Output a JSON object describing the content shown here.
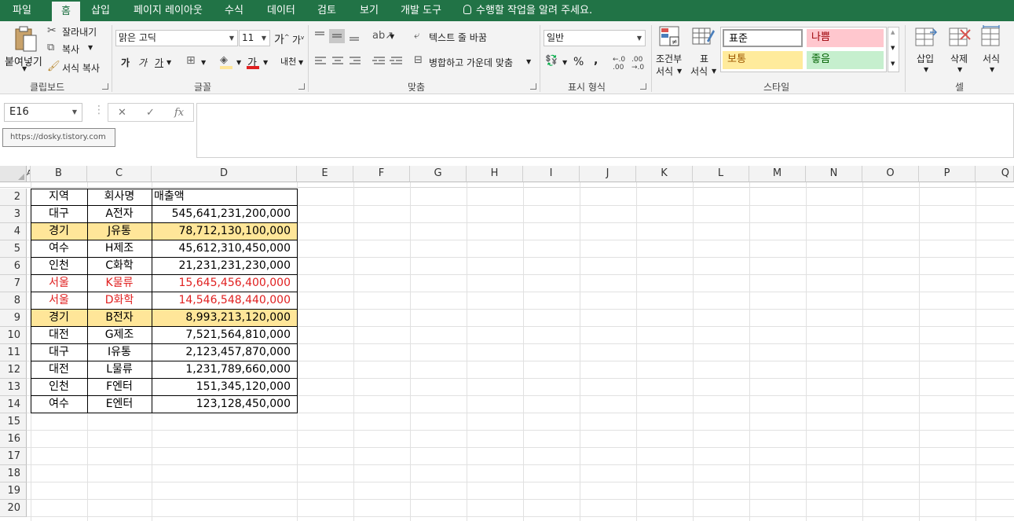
{
  "tabs": [
    "파일",
    "홈",
    "삽입",
    "페이지 레이아웃",
    "수식",
    "데이터",
    "검토",
    "보기",
    "개발 도구"
  ],
  "active_tab": "홈",
  "tell_me": "수행할 작업을 알려 주세요.",
  "clipboard": {
    "paste": "붙여넣기",
    "cut": "잘라내기",
    "copy": "복사",
    "format_painter": "서식 복사",
    "group": "클립보드"
  },
  "font": {
    "name": "맑은 고딕",
    "size": "11",
    "bold": "가",
    "italic": "가",
    "underline": "가",
    "grow": "가",
    "shrink": "가",
    "color_glyph": "가",
    "phonetic": "내천",
    "group": "글꼴"
  },
  "alignment": {
    "wrap_text": "텍스트 줄 바꿈",
    "merge_center": "병합하고 가운데 맞춤",
    "group": "맞춤"
  },
  "number": {
    "format": "일반",
    "percent": "%",
    "comma": ",",
    "group": "표시 형식"
  },
  "styles": {
    "conditional_line1": "조건부",
    "conditional_line2": "서식",
    "table_line1": "표",
    "table_line2": "서식",
    "normal": "표준",
    "bad": "나쁨",
    "neutral": "보통",
    "good": "좋음",
    "group": "스타일"
  },
  "cells": {
    "insert": "삽입",
    "delete": "삭제",
    "format": "서식",
    "group": "셀"
  },
  "name_box": "E16",
  "fx_label": "fx",
  "watermark": "https://dosky.tistory.com",
  "columns": [
    "A",
    "B",
    "C",
    "D",
    "E",
    "F",
    "G",
    "H",
    "I",
    "J",
    "K",
    "L",
    "M",
    "N",
    "O",
    "P",
    "Q"
  ],
  "rows": [
    "2",
    "3",
    "4",
    "5",
    "6",
    "7",
    "8",
    "9",
    "10",
    "11",
    "12",
    "13",
    "14",
    "15",
    "16",
    "17",
    "18",
    "19",
    "20"
  ],
  "table": {
    "header": [
      "지역",
      "회사명",
      "매출액"
    ],
    "rows": [
      {
        "region": "대구",
        "company": "A전자",
        "sales": "545,641,231,200,000",
        "style": ""
      },
      {
        "region": "경기",
        "company": "J유통",
        "sales": "78,712,130,100,000",
        "style": "hl"
      },
      {
        "region": "여수",
        "company": "H제조",
        "sales": "45,612,310,450,000",
        "style": ""
      },
      {
        "region": "인천",
        "company": "C화학",
        "sales": "21,231,231,230,000",
        "style": ""
      },
      {
        "region": "서울",
        "company": "K물류",
        "sales": "15,645,456,400,000",
        "style": "red"
      },
      {
        "region": "서울",
        "company": "D화학",
        "sales": "14,546,548,440,000",
        "style": "red"
      },
      {
        "region": "경기",
        "company": "B전자",
        "sales": "8,993,213,120,000",
        "style": "hl"
      },
      {
        "region": "대전",
        "company": "G제조",
        "sales": "7,521,564,810,000",
        "style": ""
      },
      {
        "region": "대구",
        "company": "I유통",
        "sales": "2,123,457,870,000",
        "style": ""
      },
      {
        "region": "대전",
        "company": "L물류",
        "sales": "1,231,789,660,000",
        "style": ""
      },
      {
        "region": "인천",
        "company": "F엔터",
        "sales": "151,345,120,000",
        "style": ""
      },
      {
        "region": "여수",
        "company": "E엔터",
        "sales": "123,128,450,000",
        "style": ""
      }
    ]
  },
  "colors": {
    "ribbon_green": "#217346",
    "highlight": "#ffe699",
    "red_text": "#e02020",
    "bad_bg": "#ffc7ce",
    "neutral_bg": "#ffeb9c",
    "good_bg": "#c6efce"
  }
}
